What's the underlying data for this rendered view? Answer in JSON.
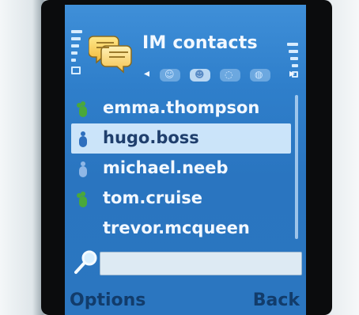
{
  "header": {
    "title": "IM contacts"
  },
  "tabs": [
    {
      "icon": "tab-contacts-icon",
      "active": false
    },
    {
      "icon": "tab-groups-icon",
      "active": true
    },
    {
      "icon": "tab-conversations-icon",
      "active": false
    },
    {
      "icon": "tab-settings-icon",
      "active": false
    }
  ],
  "contacts": [
    {
      "name": "emma.thompson",
      "status": "online",
      "status_color": "#4aa83a"
    },
    {
      "name": "hugo.boss",
      "status": "online-selected",
      "status_color": "#2e6fbe"
    },
    {
      "name": "michael.neeb",
      "status": "offline",
      "status_color": "#8fb7e6"
    },
    {
      "name": "tom.cruise",
      "status": "online",
      "status_color": "#4aa83a"
    },
    {
      "name": "trevor.mcqueen",
      "status": "none",
      "status_color": ""
    }
  ],
  "search": {
    "value": ""
  },
  "softkeys": {
    "left": "Options",
    "right": "Back"
  }
}
